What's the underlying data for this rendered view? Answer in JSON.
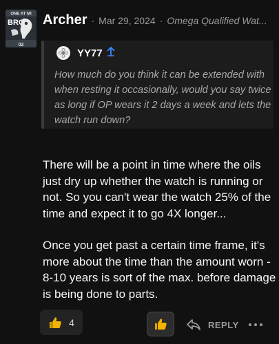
{
  "post": {
    "username": "Archer",
    "separator": "·",
    "date": "Mar 29, 2024",
    "topic": "Omega Qualified Wat..."
  },
  "avatar": {
    "top_text": "ONE AT MI",
    "mid_text": "BRO",
    "bottom_text": "02"
  },
  "quote": {
    "username": "YY77",
    "text": "How much do you think it can be extended with when resting it occasionally, would you say twice as long if OP wears it 2 days a week and lets the watch run down?"
  },
  "body": {
    "paragraph_1": "There will be a point in time where the oils just dry up whether the watch is running or not. So you can't wear the watch 25% of the time and expect it to go 4X longer...",
    "paragraph_2": "Once you get past a certain time frame, it's more about the time than the amount worn - 8-10 years is sort of the max. before damage is being done to parts."
  },
  "actions": {
    "like_count": "4",
    "reply_label": "REPLY"
  },
  "colors": {
    "background": "#111111",
    "quote_background": "#1c1c1c",
    "thumb": "#f4b400",
    "link_blue": "#3b8bff"
  },
  "icons": [
    "thumbs-up-icon",
    "reply-arrow-icon",
    "more-dots-icon",
    "quote-up-arrow-icon"
  ]
}
